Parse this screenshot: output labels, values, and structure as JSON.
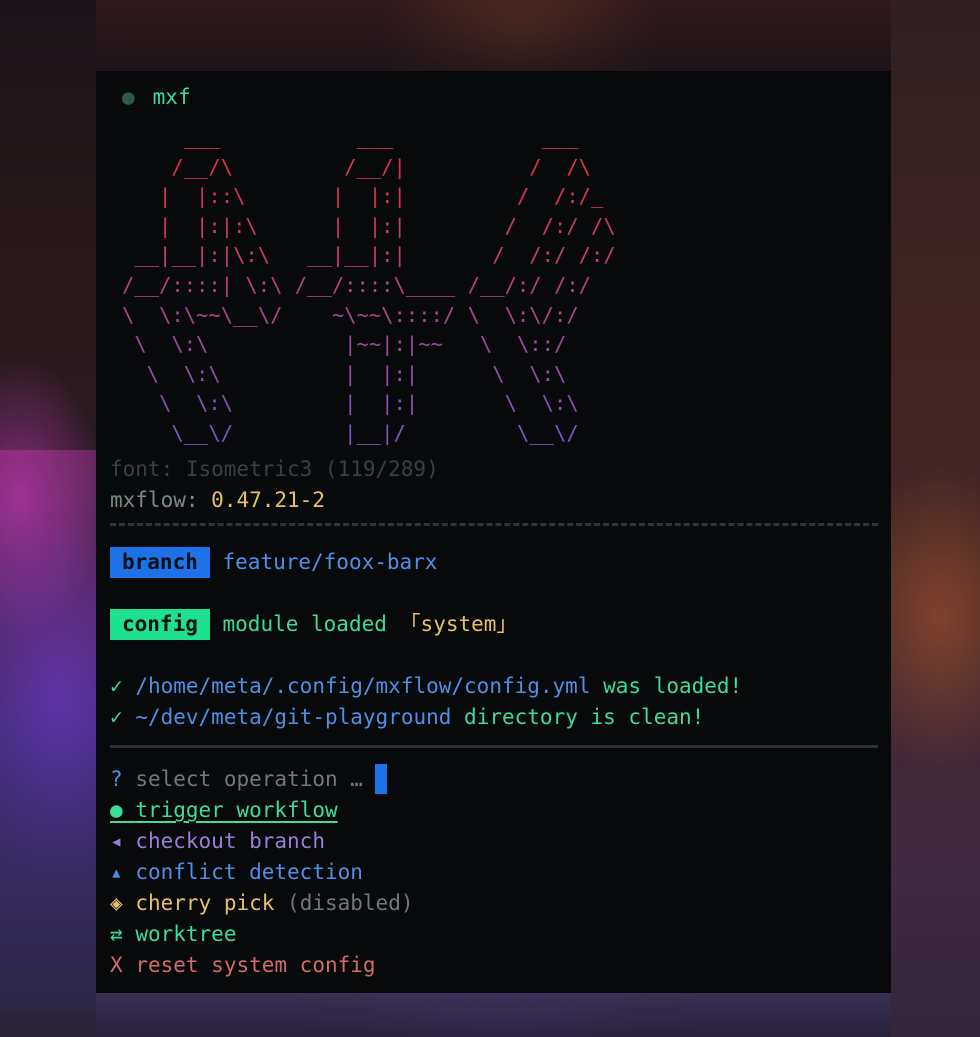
{
  "window": {
    "title": "mxf",
    "status_dot": "●"
  },
  "banner": {
    "ascii_art": "     ___           ___            ___     \n    /__/\\         /__/|          /  /\\    \n   |  |::\\       |  |:|         /  /:/_   \n   |  |:|:\\      |  |:|        /  /:/ /\\  \n __|__|:|\\:\\   __|__|:|       /  /:/ /:/  \n/__/::::| \\:\\ /__/::::\\____ /__/:/ /:/   \n\\  \\:\\~~\\__\\/    ~\\~~\\::::/ \\  \\:\\/:/    \n \\  \\:\\           |~~|:|~~   \\  \\::/     \n  \\  \\:\\          |  |:|      \\  \\:\\     \n   \\  \\:\\         |  |:|       \\  \\:\\    \n    \\__\\/         |__|/         \\__\\/    ",
    "font_info": "font: Isometric3 (119/289)",
    "app_label": "mxflow:",
    "app_version": "0.47.21-2"
  },
  "branch": {
    "badge": "branch",
    "value": "feature/foox-barx"
  },
  "config": {
    "badge": "config",
    "text": "module loaded",
    "open_bracket": "「",
    "name": "system",
    "close_bracket": "」"
  },
  "checks": [
    {
      "mark": "✓",
      "path": "/home/meta/.config/mxflow/config.yml",
      "message": "was loaded!"
    },
    {
      "mark": "✓",
      "path": "~/dev/meta/git-playground",
      "message": "directory is clean!"
    }
  ],
  "prompt": {
    "mark": "?",
    "text": "select operation",
    "ellipsis": "…"
  },
  "menu": [
    {
      "icon": "●",
      "label": "trigger workflow",
      "selected": true
    },
    {
      "icon": "◂",
      "label": "checkout branch"
    },
    {
      "icon": "▴",
      "label": "conflict detection"
    },
    {
      "icon": "◈",
      "label": "cherry pick",
      "suffix": "(disabled)"
    },
    {
      "icon": "⇄",
      "label": "worktree"
    },
    {
      "icon": "X",
      "label": "reset system config"
    }
  ],
  "colors": {
    "accent_blue": "#1d72e8",
    "accent_green": "#1fe08f",
    "terminal_bg": "#07090b"
  }
}
